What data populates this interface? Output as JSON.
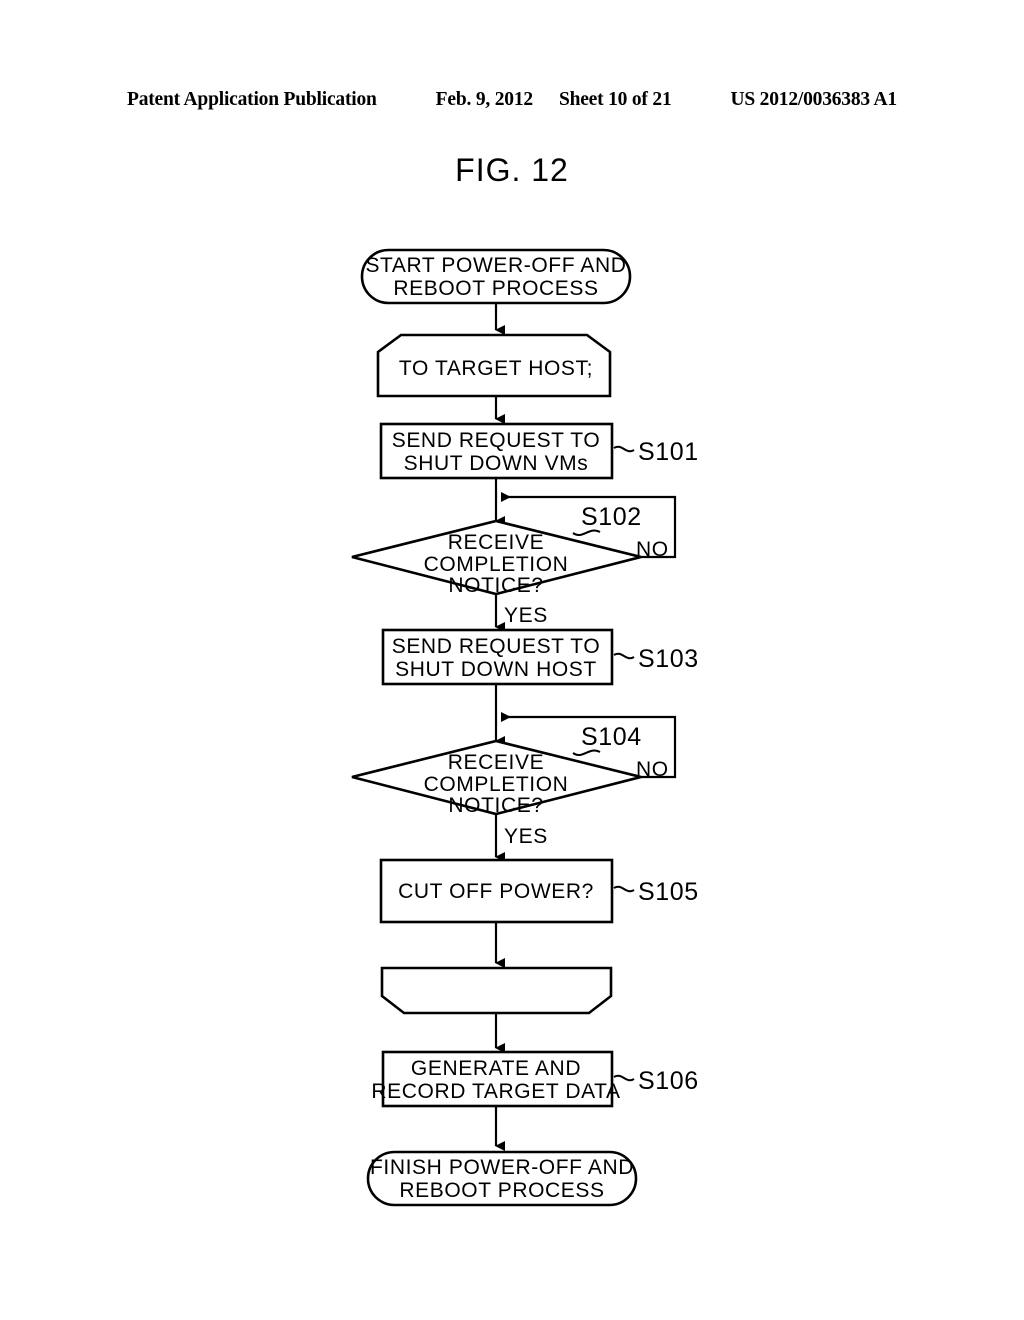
{
  "header": {
    "publication": "Patent Application Publication",
    "date": "Feb. 9, 2012",
    "sheet": "Sheet 10 of 21",
    "document_number": "US 2012/0036383 A1"
  },
  "figure": {
    "title": "FIG. 12"
  },
  "flowchart": {
    "nodes": [
      {
        "id": "start",
        "shape": "terminator",
        "lines": [
          "START POWER-OFF AND",
          "REBOOT PROCESS"
        ],
        "step": ""
      },
      {
        "id": "to-target-host",
        "shape": "chamfer-top",
        "lines": [
          "TO TARGET HOST;"
        ],
        "step": ""
      },
      {
        "id": "send-request-shutdown-vms",
        "shape": "process",
        "lines": [
          "SEND REQUEST TO",
          "SHUT DOWN VMs"
        ],
        "step": "S101"
      },
      {
        "id": "receive-completion-notice-vms",
        "shape": "decision",
        "lines": [
          "RECEIVE",
          "COMPLETION",
          "NOTICE?"
        ],
        "step": "S102",
        "yes_label": "YES",
        "no_label": "NO"
      },
      {
        "id": "send-request-shutdown-host",
        "shape": "process",
        "lines": [
          "SEND REQUEST TO",
          "SHUT DOWN HOST"
        ],
        "step": "S103"
      },
      {
        "id": "receive-completion-notice-host",
        "shape": "decision",
        "lines": [
          "RECEIVE",
          "COMPLETION",
          "NOTICE?"
        ],
        "step": "S104",
        "yes_label": "YES",
        "no_label": "NO"
      },
      {
        "id": "cut-off-power",
        "shape": "process",
        "lines": [
          "CUT OFF POWER?"
        ],
        "step": "S105"
      },
      {
        "id": "blank-chamfer-bottom",
        "shape": "chamfer-bottom",
        "lines": [],
        "step": ""
      },
      {
        "id": "generate-record-target-data",
        "shape": "process",
        "lines": [
          "GENERATE AND",
          "RECORD TARGET DATA"
        ],
        "step": "S106"
      },
      {
        "id": "finish",
        "shape": "terminator",
        "lines": [
          "FINISH POWER-OFF AND",
          "REBOOT PROCESS"
        ],
        "step": ""
      }
    ],
    "branch_labels": {
      "yes_1": "YES",
      "no_1": "NO",
      "yes_2": "YES",
      "no_2": "NO"
    },
    "step_labels": {
      "s101": "S101",
      "s102": "S102",
      "s103": "S103",
      "s104": "S104",
      "s105": "S105",
      "s106": "S106"
    },
    "node_text": {
      "start_l1": "START POWER-OFF AND",
      "start_l2": "REBOOT PROCESS",
      "target_host_l1": "TO TARGET HOST;",
      "s101_l1": "SEND REQUEST TO",
      "s101_l2": "SHUT DOWN VMs",
      "s102_l1": "RECEIVE",
      "s102_l2": "COMPLETION",
      "s102_l3": "NOTICE?",
      "s103_l1": "SEND REQUEST TO",
      "s103_l2": "SHUT DOWN HOST",
      "s104_l1": "RECEIVE",
      "s104_l2": "COMPLETION",
      "s104_l3": "NOTICE?",
      "s105_l1": "CUT OFF POWER?",
      "s106_l1": "GENERATE AND",
      "s106_l2": "RECORD TARGET DATA",
      "finish_l1": "FINISH POWER-OFF AND",
      "finish_l2": "REBOOT PROCESS"
    }
  },
  "colors": {
    "background": "#ffffff",
    "ink": "#000000"
  }
}
